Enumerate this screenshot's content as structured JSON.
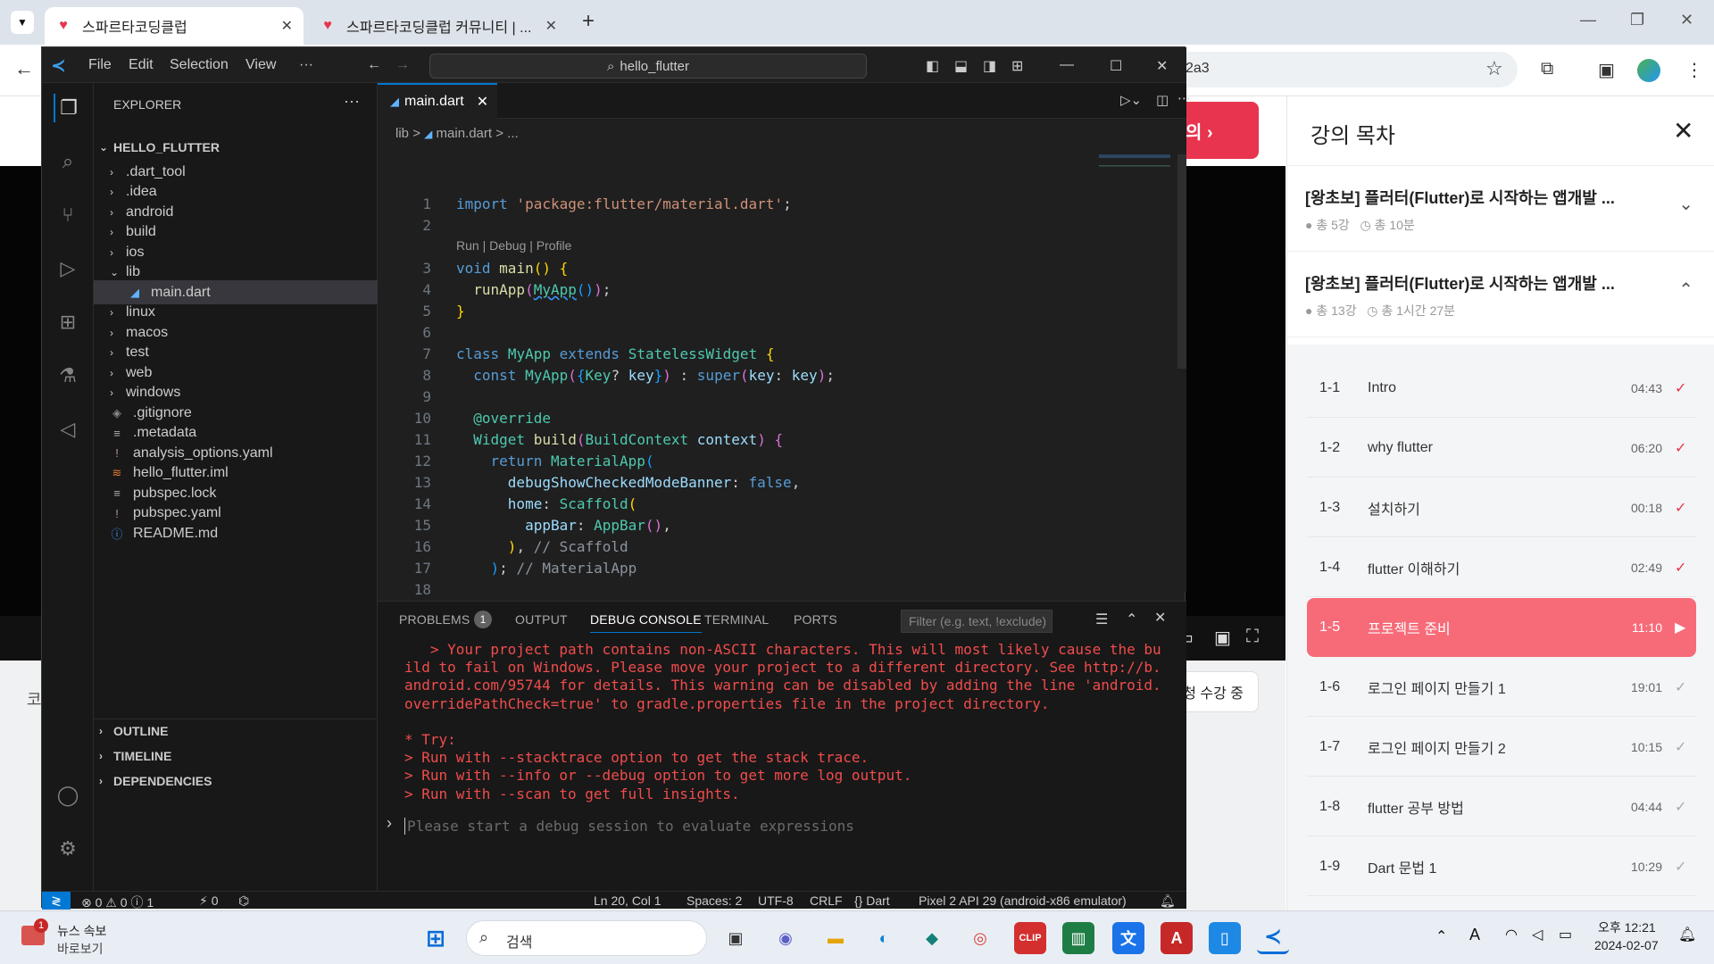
{
  "browser": {
    "tabs": [
      {
        "title": "스파르타코딩클럽"
      },
      {
        "title": "스파르타코딩클럽 커뮤니티 | ..."
      }
    ],
    "address_fragment": "2a3",
    "new_tab": "+"
  },
  "page": {
    "cta": "의 ›",
    "enroll": "청 수강 중",
    "left_char": "코"
  },
  "course": {
    "title": "강의 목차",
    "sections": [
      {
        "title": "[왕초보] 플러터(Flutter)로 시작하는 앱개발 ...",
        "count": "총 5강",
        "time": "총 10분"
      },
      {
        "title": "[왕초보] 플러터(Flutter)로 시작하는 앱개발 ...",
        "count": "총 13강",
        "time": "총 1시간 27분"
      }
    ],
    "lessons": [
      {
        "num": "1-1",
        "title": "Intro",
        "dur": "04:43",
        "status": "done"
      },
      {
        "num": "1-2",
        "title": "why flutter",
        "dur": "06:20",
        "status": "done"
      },
      {
        "num": "1-3",
        "title": "설치하기",
        "dur": "00:18",
        "status": "done"
      },
      {
        "num": "1-4",
        "title": "flutter 이해하기",
        "dur": "02:49",
        "status": "done"
      },
      {
        "num": "1-5",
        "title": "프로젝트 준비",
        "dur": "11:10",
        "status": "active"
      },
      {
        "num": "1-6",
        "title": "로그인 페이지 만들기 1",
        "dur": "19:01",
        "status": "todo"
      },
      {
        "num": "1-7",
        "title": "로그인 페이지 만들기 2",
        "dur": "10:15",
        "status": "todo"
      },
      {
        "num": "1-8",
        "title": "flutter 공부 방법",
        "dur": "04:44",
        "status": "todo"
      },
      {
        "num": "1-9",
        "title": "Dart 문법 1",
        "dur": "10:29",
        "status": "todo"
      }
    ]
  },
  "vscode": {
    "menu": [
      "File",
      "Edit",
      "Selection",
      "View",
      "···"
    ],
    "search": "hello_flutter",
    "explorer_title": "EXPLORER",
    "project": "HELLO_FLUTTER",
    "tree": [
      {
        "label": ".dart_tool",
        "kind": "folder"
      },
      {
        "label": ".idea",
        "kind": "folder"
      },
      {
        "label": "android",
        "kind": "folder"
      },
      {
        "label": "build",
        "kind": "folder"
      },
      {
        "label": "ios",
        "kind": "folder"
      },
      {
        "label": "lib",
        "kind": "open"
      },
      {
        "label": "main.dart",
        "kind": "dart"
      },
      {
        "label": "linux",
        "kind": "folder"
      },
      {
        "label": "macos",
        "kind": "folder"
      },
      {
        "label": "test",
        "kind": "folder"
      },
      {
        "label": "web",
        "kind": "folder"
      },
      {
        "label": "windows",
        "kind": "folder"
      },
      {
        "label": ".gitignore",
        "kind": "git"
      },
      {
        "label": ".metadata",
        "kind": "meta"
      },
      {
        "label": "analysis_options.yaml",
        "kind": "yaml"
      },
      {
        "label": "hello_flutter.iml",
        "kind": "iml"
      },
      {
        "label": "pubspec.lock",
        "kind": "lock"
      },
      {
        "label": "pubspec.yaml",
        "kind": "yaml"
      },
      {
        "label": "README.md",
        "kind": "info"
      }
    ],
    "bottom_sections": [
      "OUTLINE",
      "TIMELINE",
      "DEPENDENCIES"
    ],
    "tab": "main.dart",
    "breadcrumb": [
      "lib",
      ">",
      "main.dart",
      ">",
      "..."
    ],
    "codelens": "Run | Debug | Profile",
    "panel_tabs": [
      "PROBLEMS",
      "OUTPUT",
      "DEBUG CONSOLE",
      "TERMINAL",
      "PORTS"
    ],
    "problem_count": "1",
    "filter_placeholder": "Filter (e.g. text, !exclude)",
    "output": [
      "   > Your project path contains non-ASCII characters. This will most likely cause the bu",
      "ild to fail on Windows. Please move your project to a different directory. See http://b.",
      "android.com/95744 for details. This warning can be disabled by adding the line 'android.",
      "overridePathCheck=true' to gradle.properties file in the project directory.",
      "",
      "* Try:",
      "> Run with --stacktrace option to get the stack trace.",
      "> Run with --info or --debug option to get more log output.",
      "> Run with --scan to get full insights."
    ],
    "repl_placeholder": "Please start a debug session to evaluate expressions",
    "status": {
      "errors": "0",
      "warnings": "0",
      "info": "1",
      "ports": "0",
      "position": "Ln 20, Col 1",
      "spaces": "Spaces: 2",
      "encoding": "UTF-8",
      "eol": "CRLF",
      "lang": "Dart",
      "device": "Pixel 2 API 29 (android-x86 emulator)"
    }
  },
  "taskbar": {
    "news_title": "뉴스 속보",
    "news_sub": "바로보기",
    "news_badge": "1",
    "search": "검색",
    "time": "오후 12:21",
    "date": "2024-02-07"
  },
  "colors": {
    "accent": "#e8344e",
    "vscode_bg": "#1f1f1f",
    "active_lesson": "#f76b79"
  }
}
